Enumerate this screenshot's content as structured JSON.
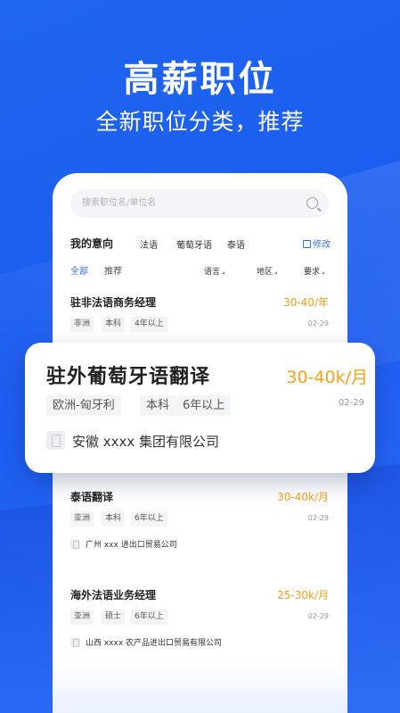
{
  "hero": {
    "title": "高薪职位",
    "subtitle": "全新职位分类，推荐"
  },
  "search": {
    "placeholder": "搜索职位名/单位名"
  },
  "intent": {
    "title": "我的意向",
    "tags": [
      "法语",
      "葡萄牙语",
      "泰语"
    ],
    "edit_label": "修改"
  },
  "filters": {
    "tabs": [
      "全部",
      "推荐"
    ],
    "dropdowns": [
      "语言",
      "地区",
      "要求"
    ]
  },
  "jobs": [
    {
      "title": "驻非法语商务经理",
      "salary": "30-40/年",
      "tags": [
        "非洲",
        "本科",
        "4年以上"
      ],
      "date": "02-29",
      "company": ""
    },
    {
      "title": "泰语翻译",
      "salary": "30-40k/月",
      "tags": [
        "亚洲",
        "本科",
        "6年以上"
      ],
      "date": "02-29",
      "company": "广州 xxx 进出口贸易公司"
    },
    {
      "title": "海外法语业务经理",
      "salary": "25-30k/月",
      "tags": [
        "亚洲",
        "硕士",
        "6年以上"
      ],
      "date": "02-29",
      "company": "山西 xxxx 农产品进出口贸易有限公司"
    }
  ],
  "featured": {
    "title": "驻外葡萄牙语翻译",
    "salary": "30-40k/月",
    "tags": [
      "欧洲-匈牙利",
      "本科",
      "6年以上"
    ],
    "date": "02-29",
    "company": "安徽 xxxx 集团有限公司"
  },
  "colors": {
    "brand": "#1f66ee",
    "accent": "#3a72f2",
    "salary": "#f7a21c"
  }
}
